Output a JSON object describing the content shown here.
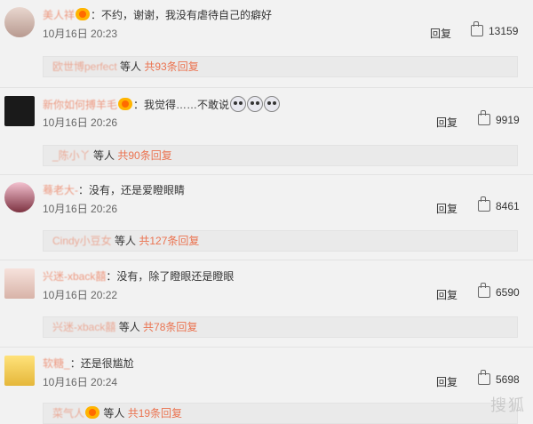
{
  "comments": [
    {
      "username": "美人祥",
      "text": "：不约，谢谢，我没有虐待自己的癖好",
      "date": "10月16日 20:23",
      "reply": "回复",
      "likes": "13159",
      "sub_user": "欧世博perfect",
      "sub_mid": " 等人 ",
      "sub_count": "共93条回复"
    },
    {
      "username": "新你如何搏羊毛",
      "text": "：我觉得……不敢说",
      "date": "10月16日 20:26",
      "reply": "回复",
      "likes": "9919",
      "sub_user": "_陈小丫",
      "sub_mid": " 等人 ",
      "sub_count": "共90条回复"
    },
    {
      "username": "蓦老大-",
      "text": "：没有，还是爱瞪眼睛",
      "date": "10月16日 20:26",
      "reply": "回复",
      "likes": "8461",
      "sub_user": "Cindy小豆女",
      "sub_mid": " 等人 ",
      "sub_count": "共127条回复"
    },
    {
      "username": "兴迷-xback囍",
      "text": "：没有，除了瞪眼还是瞪眼",
      "date": "10月16日 20:22",
      "reply": "回复",
      "likes": "6590",
      "sub_user": "兴迷-xback囍",
      "sub_mid": " 等人 ",
      "sub_count": "共78条回复"
    },
    {
      "username": "软糖_",
      "text": "：还是很尴尬",
      "date": "10月16日 20:24",
      "reply": "回复",
      "likes": "5698",
      "sub_user": "菜气人",
      "sub_mid": " 等人 ",
      "sub_count": "共19条回复"
    }
  ],
  "watermark": "搜狐",
  "colors": {
    "accent": "#eb7350",
    "background": "#f2f2f2"
  }
}
